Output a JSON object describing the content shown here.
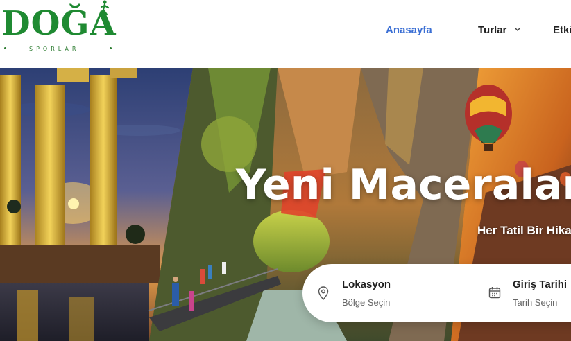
{
  "brand": {
    "name": "DOĞA",
    "subtitle": "SPORLARI",
    "color": "#1f8a32"
  },
  "nav": {
    "items": [
      {
        "label": "Anasayfa",
        "active": true
      },
      {
        "label": "Turlar",
        "has_dropdown": true
      },
      {
        "label": "Etki"
      }
    ],
    "active_color": "#3b6fd4"
  },
  "hero": {
    "title": "Yeni Maceralar,",
    "subtitle": "Her Tatil Bir Hikay"
  },
  "search": {
    "fields": [
      {
        "label": "Lokasyon",
        "value": "Bölge Seçin",
        "icon": "map-pin-icon"
      },
      {
        "label": "Giriş Tarihi",
        "value": "Tarih Seçin",
        "icon": "calendar-icon"
      }
    ]
  }
}
